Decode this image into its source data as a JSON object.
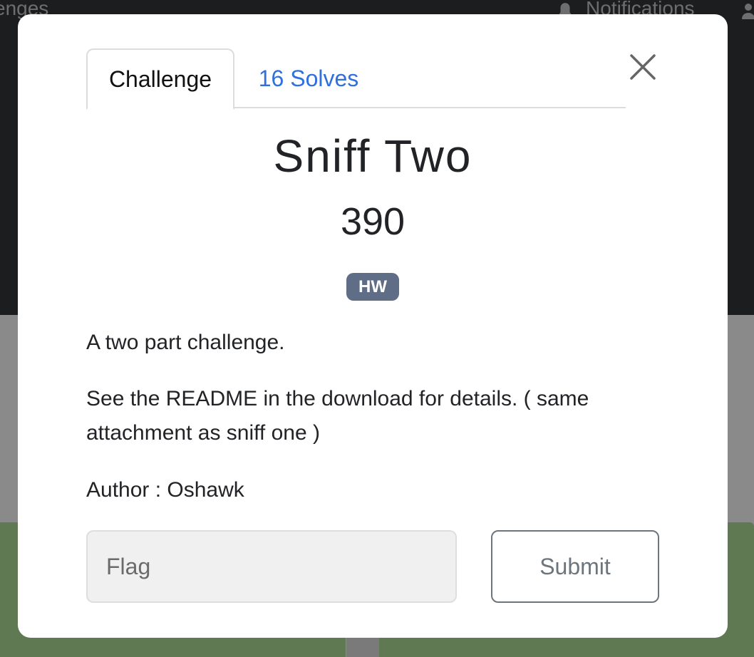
{
  "background": {
    "nav_left_text": "enges",
    "nav_right_text": "Notifications"
  },
  "modal": {
    "tabs": [
      {
        "label": "Challenge",
        "active": true
      },
      {
        "label": "16 Solves",
        "active": false
      }
    ],
    "title": "Sniff Two",
    "points": "390",
    "category_badge": "HW",
    "description": [
      "A two part challenge.",
      "See the README in the download for details. ( same attachment as sniff one )",
      "Author : Oshawk"
    ],
    "flag_input": {
      "placeholder": "Flag",
      "value": ""
    },
    "submit_label": "Submit",
    "close_icon": "close-icon"
  },
  "colors": {
    "backdrop_top": "#1c1d1f",
    "backdrop_mid": "#8a8a8a",
    "card_green": "#5f7a52",
    "link_blue": "#2f6fde",
    "badge": "#5f6d86"
  }
}
